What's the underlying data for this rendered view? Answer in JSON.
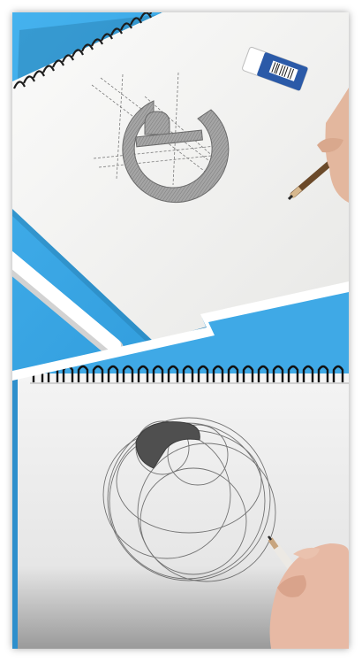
{
  "image": {
    "kind": "photo-collage",
    "panels": [
      {
        "position": "top",
        "subject": "notebook-with-geometric-logo-sketch",
        "colors": {
          "background": "#3aa7e4",
          "paper": "#f4f4f2",
          "pencil": "#6b4a2a",
          "graphite": "#8a8a8a"
        }
      },
      {
        "position": "bottom",
        "subject": "notebook-with-circle-construction-sketch",
        "colors": {
          "paper": "#ececec",
          "graphite": "#6f6f6f",
          "skin": "#e7b9a4"
        }
      }
    ],
    "divider": "lightning-bolt-split",
    "eraser_label": "",
    "caption": ""
  }
}
